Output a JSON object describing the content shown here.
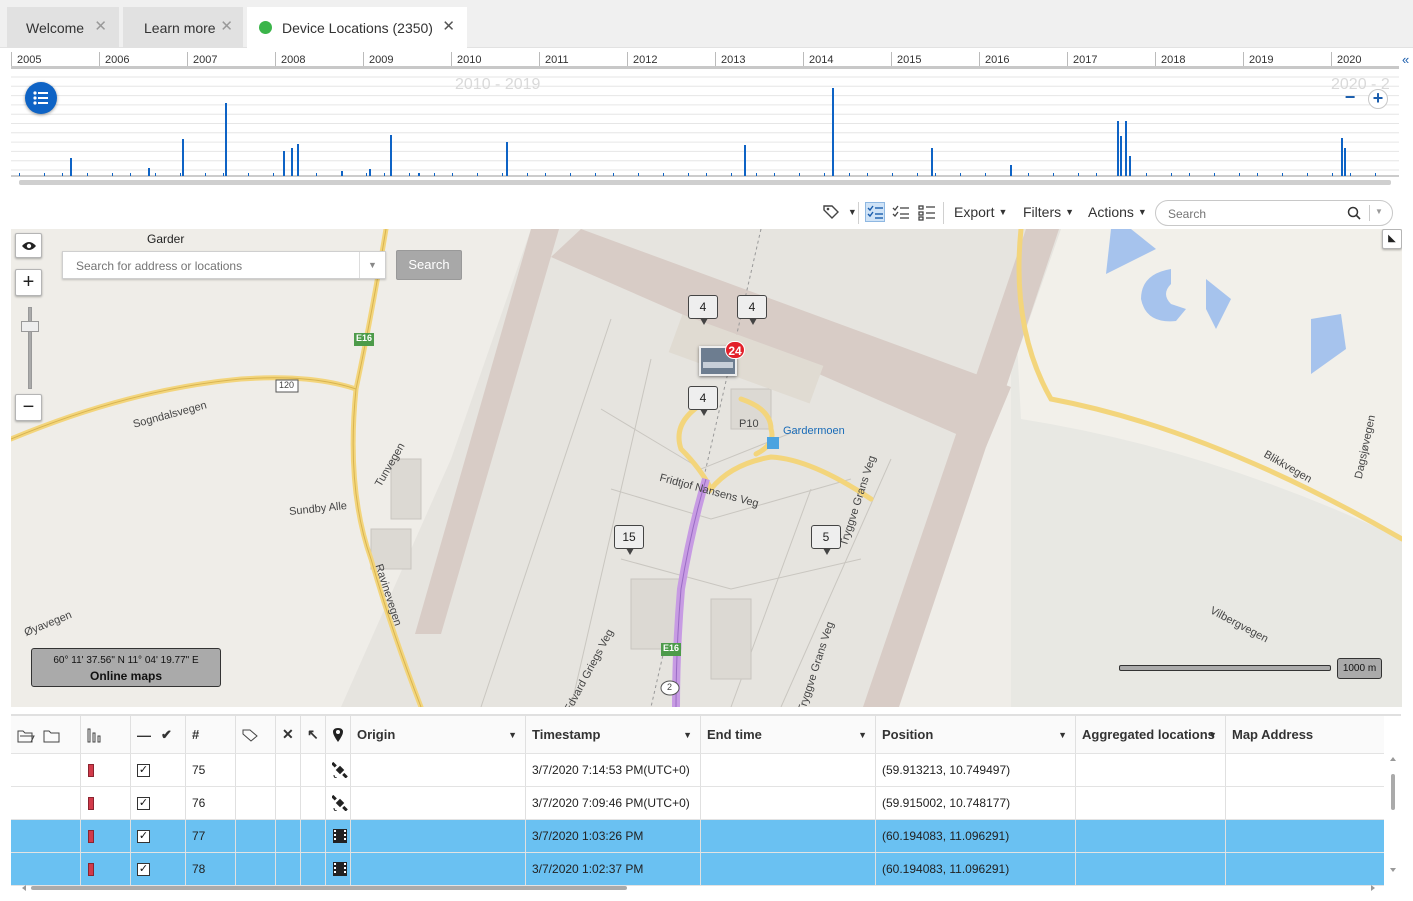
{
  "tabs": [
    {
      "label": "Welcome"
    },
    {
      "label": "Learn more"
    },
    {
      "label": "Device Locations (2350)"
    }
  ],
  "timeline": {
    "years": [
      "2005",
      "2006",
      "2007",
      "2008",
      "2009",
      "2010",
      "2011",
      "2012",
      "2013",
      "2014",
      "2015",
      "2016",
      "2017",
      "2018",
      "2019",
      "2020"
    ],
    "range_label": "2010 - 2019",
    "range_label_right": "2020 - 2",
    "zoom_out": "−",
    "zoom_in": "+"
  },
  "toolbar": {
    "export": "Export",
    "filters": "Filters",
    "actions": "Actions",
    "search_placeholder": "Search"
  },
  "map": {
    "title": "Garder",
    "address_placeholder": "Search for address or locations",
    "search_button": "Search",
    "zoom_in": "+",
    "zoom_out": "−",
    "clusters": [
      "4",
      "4",
      "4",
      "15",
      "5"
    ],
    "badge": "24",
    "coords": "60° 11' 37.56\" N 11° 04' 19.77\" E",
    "online_maps": "Online maps",
    "scale": "1000 m",
    "labels": {
      "sogndalsvegen": "Sogndalsvegen",
      "tunvegen": "Tunvegen",
      "sundby": "Sundby Alle",
      "ravinevegen": "Ravinevegen",
      "oyavegen": "Øyavegen",
      "gardermoen": "Gardermoen",
      "p10": "P10",
      "fridtjof": "Fridtjof Nansens Veg",
      "tryggve1": "Tryggve Grans Veg",
      "tryggve2": "Tryggve Grans Veg",
      "edvard": "Edvard Griegs Veg",
      "blikkvegen": "Blikkvegen",
      "dagsjovegen": "Dagsjøvegen",
      "vilbergvegen": "Vilbergvegen",
      "e16a": "E16",
      "e16b": "E16",
      "r120": "120",
      "r2": "2"
    }
  },
  "grid": {
    "columns": {
      "num": "#",
      "origin": "Origin",
      "timestamp": "Timestamp",
      "end_time": "End time",
      "position": "Position",
      "aggregated": "Aggregated locations",
      "map_address": "Map Address"
    },
    "rows": [
      {
        "num": "75",
        "timestamp": "3/7/2020 7:14:53 PM(UTC+0)",
        "position": "(59.913213, 10.749497)",
        "type": "satellite",
        "selected": false
      },
      {
        "num": "76",
        "timestamp": "3/7/2020 7:09:46 PM(UTC+0)",
        "position": "(59.915002, 10.748177)",
        "type": "satellite",
        "selected": false
      },
      {
        "num": "77",
        "timestamp": "3/7/2020 1:03:26 PM",
        "position": "(60.194083, 11.096291)",
        "type": "film",
        "selected": true
      },
      {
        "num": "78",
        "timestamp": "3/7/2020 1:02:37 PM",
        "position": "(60.194083, 11.096291)",
        "type": "film",
        "selected": true
      }
    ]
  },
  "colors": {
    "accent": "#0e63c5",
    "selection": "#6ac1f2",
    "tab_dot": "#3bb54a",
    "badge": "#e3202a"
  }
}
